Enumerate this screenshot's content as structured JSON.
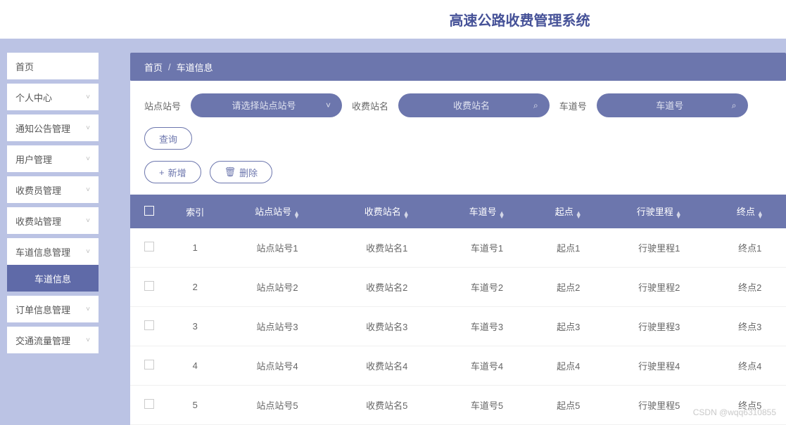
{
  "header": {
    "title": "高速公路收费管理系统"
  },
  "sidebar": {
    "items": [
      {
        "label": "首页",
        "hasChevron": false
      },
      {
        "label": "个人中心",
        "hasChevron": true
      },
      {
        "label": "通知公告管理",
        "hasChevron": true
      },
      {
        "label": "用户管理",
        "hasChevron": true
      },
      {
        "label": "收费员管理",
        "hasChevron": true
      },
      {
        "label": "收费站管理",
        "hasChevron": true
      },
      {
        "label": "车道信息管理",
        "hasChevron": true
      },
      {
        "label": "车道信息",
        "hasChevron": false,
        "sub": true
      },
      {
        "label": "订单信息管理",
        "hasChevron": true
      },
      {
        "label": "交通流量管理",
        "hasChevron": true
      }
    ]
  },
  "breadcrumb": {
    "home": "首页",
    "current": "车道信息"
  },
  "filters": {
    "f1_label": "站点站号",
    "f1_placeholder": "请选择站点站号",
    "f2_label": "收费站名",
    "f2_placeholder": "收费站名",
    "f3_label": "车道号",
    "f3_placeholder": "车道号",
    "search_label": "查询"
  },
  "actions": {
    "add": "新增",
    "delete": "删除"
  },
  "table": {
    "columns": [
      "",
      "索引",
      "站点站号",
      "收费站名",
      "车道号",
      "起点",
      "行驶里程",
      "终点"
    ],
    "rows": [
      {
        "idx": "1",
        "c1": "站点站号1",
        "c2": "收费站名1",
        "c3": "车道号1",
        "c4": "起点1",
        "c5": "行驶里程1",
        "c6": "终点1"
      },
      {
        "idx": "2",
        "c1": "站点站号2",
        "c2": "收费站名2",
        "c3": "车道号2",
        "c4": "起点2",
        "c5": "行驶里程2",
        "c6": "终点2"
      },
      {
        "idx": "3",
        "c1": "站点站号3",
        "c2": "收费站名3",
        "c3": "车道号3",
        "c4": "起点3",
        "c5": "行驶里程3",
        "c6": "终点3"
      },
      {
        "idx": "4",
        "c1": "站点站号4",
        "c2": "收费站名4",
        "c3": "车道号4",
        "c4": "起点4",
        "c5": "行驶里程4",
        "c6": "终点4"
      },
      {
        "idx": "5",
        "c1": "站点站号5",
        "c2": "收费站名5",
        "c3": "车道号5",
        "c4": "起点5",
        "c5": "行驶里程5",
        "c6": "终点5"
      }
    ]
  },
  "watermark": "CSDN @wqq6310855"
}
